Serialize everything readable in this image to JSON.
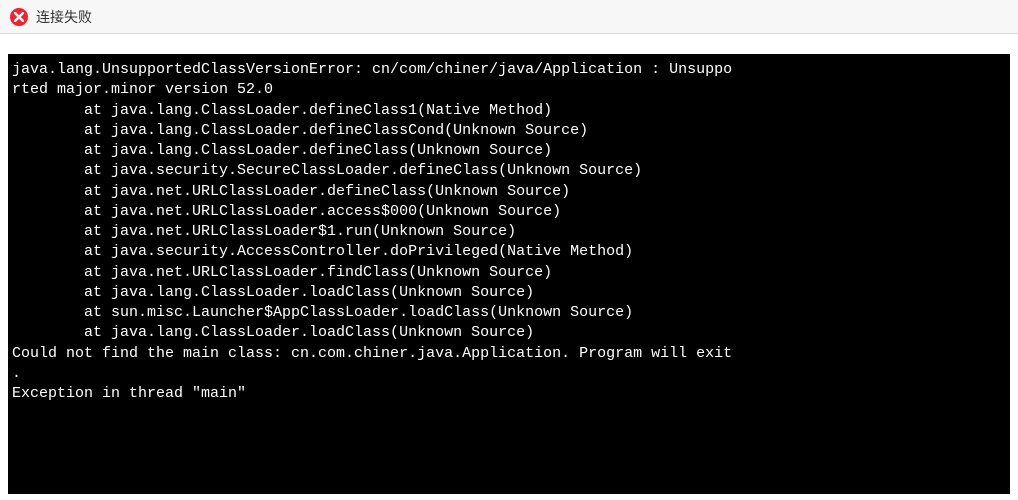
{
  "header": {
    "title": "连接失败"
  },
  "terminal": {
    "lines": [
      "java.lang.UnsupportedClassVersionError: cn/com/chiner/java/Application : Unsuppo",
      "rted major.minor version 52.0",
      "        at java.lang.ClassLoader.defineClass1(Native Method)",
      "        at java.lang.ClassLoader.defineClassCond(Unknown Source)",
      "        at java.lang.ClassLoader.defineClass(Unknown Source)",
      "        at java.security.SecureClassLoader.defineClass(Unknown Source)",
      "        at java.net.URLClassLoader.defineClass(Unknown Source)",
      "        at java.net.URLClassLoader.access$000(Unknown Source)",
      "        at java.net.URLClassLoader$1.run(Unknown Source)",
      "        at java.security.AccessController.doPrivileged(Native Method)",
      "        at java.net.URLClassLoader.findClass(Unknown Source)",
      "        at java.lang.ClassLoader.loadClass(Unknown Source)",
      "        at sun.misc.Launcher$AppClassLoader.loadClass(Unknown Source)",
      "        at java.lang.ClassLoader.loadClass(Unknown Source)",
      "Could not find the main class: cn.com.chiner.java.Application. Program will exit",
      ".",
      "Exception in thread \"main\" "
    ]
  }
}
